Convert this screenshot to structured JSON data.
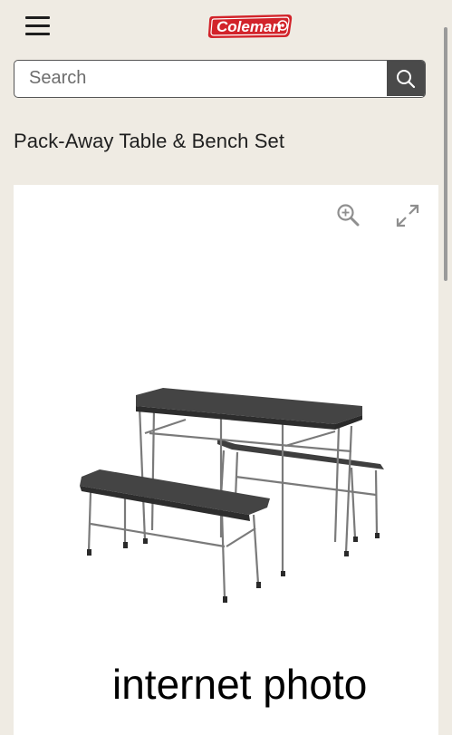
{
  "header": {
    "logo_text": "Coleman",
    "menu_icon": "hamburger-menu-icon"
  },
  "search": {
    "placeholder": "Search",
    "value": "",
    "icon": "search-icon"
  },
  "product": {
    "title": "Pack-Away Table & Bench Set",
    "image_alt": "Pack-Away Table & Bench Set",
    "watermark": "internet photo"
  },
  "image_controls": {
    "zoom_icon": "zoom-in-icon",
    "expand_icon": "expand-icon"
  },
  "colors": {
    "background": "#efebe3",
    "brand_red": "#d2232a",
    "search_button": "#4a4a4a"
  }
}
